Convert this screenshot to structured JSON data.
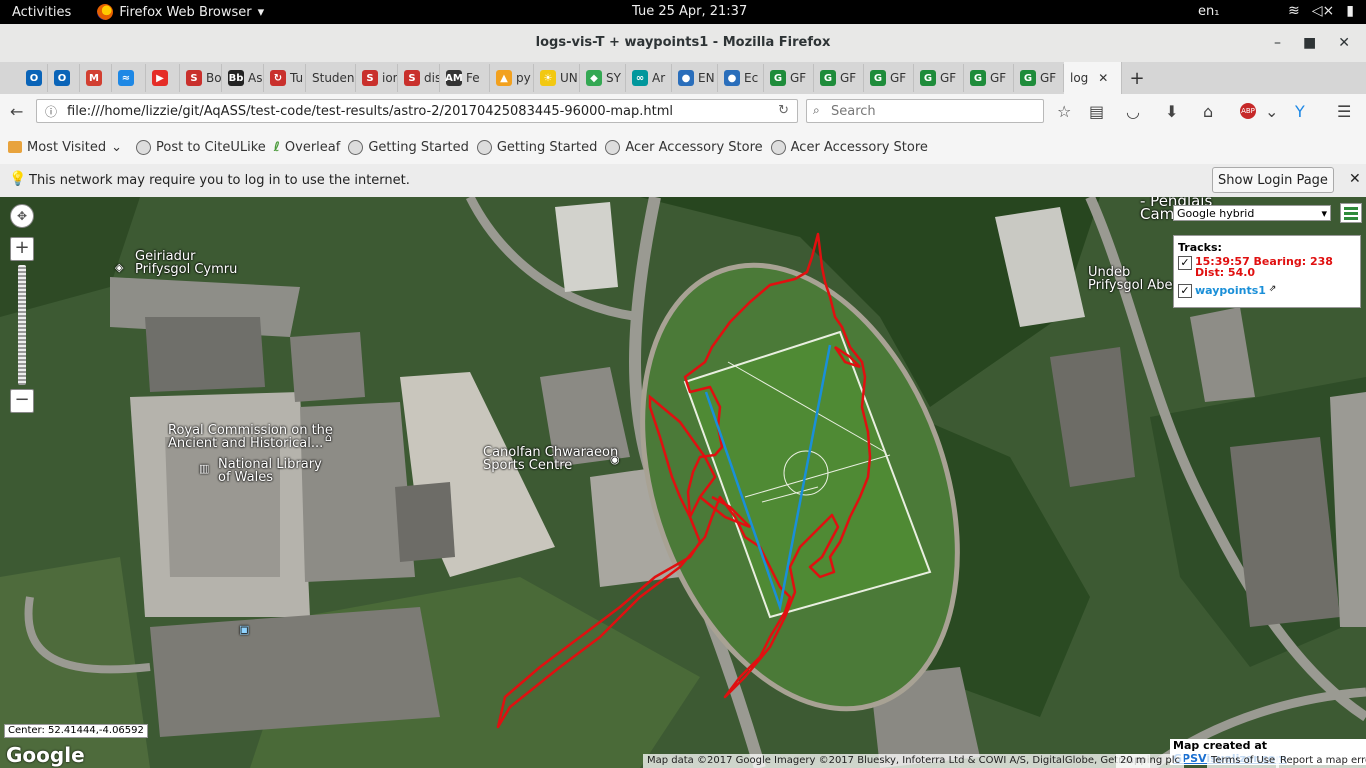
{
  "topbar": {
    "activities": "Activities",
    "app_name": "Firefox Web Browser",
    "clock": "Tue 25 Apr, 21:37",
    "language": "en₁",
    "icons": [
      "wifi-icon",
      "volume-muted-icon",
      "battery-icon"
    ]
  },
  "window": {
    "title": "logs-vis-T + waypoints1 - Mozilla Firefox",
    "controls": [
      "–",
      "■",
      "✕"
    ]
  },
  "tabs": [
    {
      "label": "",
      "icon": "outlook",
      "color": "#0a64b8",
      "glyph": "O"
    },
    {
      "label": "",
      "icon": "outlook",
      "color": "#0a64b8",
      "glyph": "O"
    },
    {
      "label": "",
      "icon": "gmail",
      "color": "#d23f31",
      "glyph": "M"
    },
    {
      "label": "",
      "icon": "messenger",
      "color": "#1e88e5",
      "glyph": "≈"
    },
    {
      "label": "",
      "icon": "youtube",
      "color": "#e52d27",
      "glyph": "▶"
    },
    {
      "label": "Bo",
      "icon": "s",
      "color": "#c9302c",
      "glyph": "S"
    },
    {
      "label": "As",
      "icon": "blackboard",
      "color": "#222",
      "glyph": "Bb"
    },
    {
      "label": "Tu",
      "icon": "turnitin",
      "color": "#c9302c",
      "glyph": "↻"
    },
    {
      "label": "Studen",
      "icon": "none",
      "color": "#999",
      "glyph": ""
    },
    {
      "label": "ion",
      "icon": "s",
      "color": "#c9302c",
      "glyph": "S"
    },
    {
      "label": "dis",
      "icon": "s",
      "color": "#c9302c",
      "glyph": "S"
    },
    {
      "label": "Fe",
      "icon": "am",
      "color": "#333",
      "glyph": "AM"
    },
    {
      "label": "py",
      "icon": "py",
      "color": "#f2a11e",
      "glyph": "▲"
    },
    {
      "label": "UN",
      "icon": "sun",
      "color": "#f2c811",
      "glyph": "☀"
    },
    {
      "label": "SY",
      "icon": "maps",
      "color": "#34a853",
      "glyph": "◆"
    },
    {
      "label": "Ar",
      "icon": "arduino",
      "color": "#00979c",
      "glyph": "∞"
    },
    {
      "label": "EN",
      "icon": "globe",
      "color": "#2a6ebb",
      "glyph": "●"
    },
    {
      "label": "Ec",
      "icon": "globe",
      "color": "#2a6ebb",
      "glyph": "●"
    },
    {
      "label": "GF",
      "icon": "gps",
      "color": "#1e8c3a",
      "glyph": "G"
    },
    {
      "label": "GF",
      "icon": "gps",
      "color": "#1e8c3a",
      "glyph": "G"
    },
    {
      "label": "GF",
      "icon": "gps",
      "color": "#1e8c3a",
      "glyph": "G"
    },
    {
      "label": "GF",
      "icon": "gps",
      "color": "#1e8c3a",
      "glyph": "G"
    },
    {
      "label": "GF",
      "icon": "gps",
      "color": "#1e8c3a",
      "glyph": "G"
    },
    {
      "label": "GF",
      "icon": "gps",
      "color": "#1e8c3a",
      "glyph": "G"
    }
  ],
  "active_tab": {
    "label": "log",
    "close": "✕"
  },
  "new_tab": "+",
  "navbar": {
    "url": "file:///home/lizzie/git/AqASS/test-code/test-results/astro-2/20170425083445-96000-map.html",
    "search_placeholder": "Search"
  },
  "bookmarks": [
    "Most Visited",
    "Post to CiteULike",
    "Overleaf",
    "Getting Started",
    "Getting Started",
    "Acer Accessory Store",
    "Acer Accessory Store"
  ],
  "notification": {
    "message": "This network may require you to log in to use the internet.",
    "button": "Show Login Page",
    "close": "✕"
  },
  "map": {
    "layer_select": "Google hybrid",
    "tracks_header": "Tracks:",
    "track1_label": "15:39:57 Bearing: 238 Dist: 54.0",
    "track1_color": "#e01010",
    "track2_label": "waypoints1",
    "track2_color": "#1a8fd8",
    "labels": {
      "geiriadur": "Geiriadur\nPrifysgol Cymru",
      "royal_commission": "Royal Commission on the\nAncient and Historical...",
      "national_library": "National Library\nof Wales",
      "canolfan": "Canolfan Chwaraeon\nSports Centre",
      "undeb": "Undeb\nPrifysgol Aber",
      "penglais": "- Penglais\nCam"
    },
    "center": "Center: 52.41444,-4.06592",
    "google": "Google",
    "credit_prefix": "Map created at",
    "credit_link": "GPSVisualizer.com",
    "attribution": "Map data ©2017 Google Imagery ©2017 Bluesky, Infoterra Ltd & COWI A/S, DigitalGlobe, Getmapping plc",
    "scale": "20 m",
    "terms": "Terms of Use",
    "report": "Report a map error"
  }
}
